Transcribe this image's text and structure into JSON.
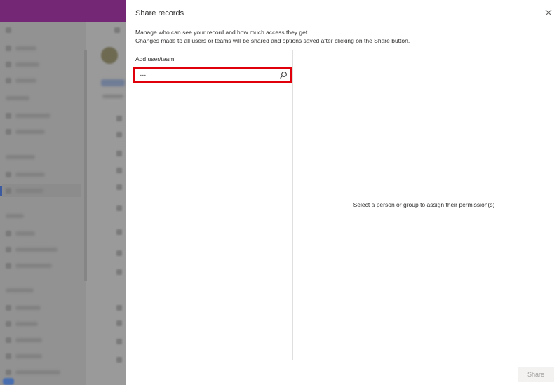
{
  "dialog": {
    "title": "Share records",
    "close_icon": "close-icon",
    "description_line1": "Manage who can see your record and how much access they get.",
    "description_line2": "Changes made to all users or teams will be shared and options saved after clicking on the Share button.",
    "add_label": "Add user/team",
    "search": {
      "value": "---",
      "icon": "search-icon"
    },
    "empty_message": "Select a person or group to assign their permission(s)",
    "share_button": "Share",
    "share_button_state": "disabled"
  },
  "colors": {
    "topbar": "#742774",
    "highlight": "#e0000b",
    "share_disabled_bg": "#f3f2f1"
  }
}
